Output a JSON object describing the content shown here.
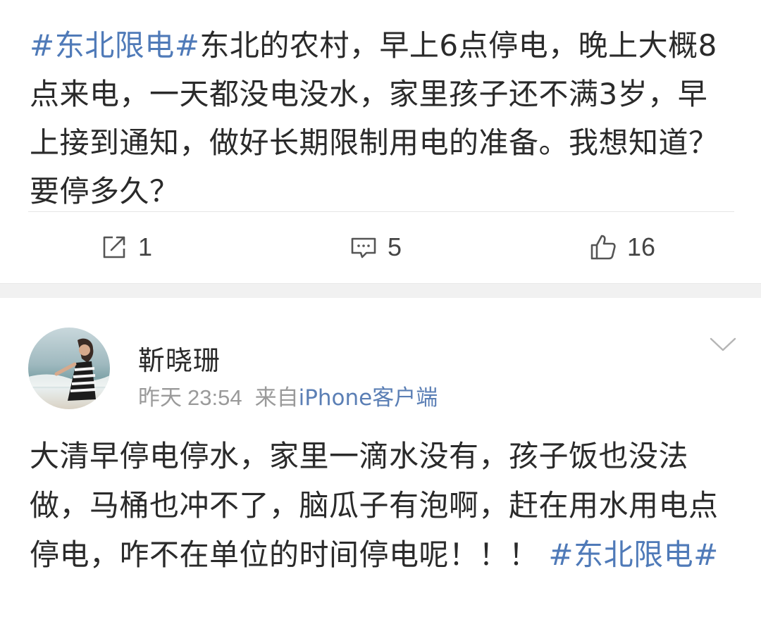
{
  "post": {
    "topic": "#东北限电#",
    "text": "东北的农村，早上6点停电，晚上大概8点来电，一天都没电没水，家里孩子还不满3岁，早上接到通知，做好长期限制用电的准备。我想知道？要停多久？",
    "actions": {
      "repost": {
        "icon": "repost-icon",
        "count": "1"
      },
      "comment": {
        "icon": "comment-icon",
        "count": "5"
      },
      "like": {
        "icon": "thumbs-up-icon",
        "count": "16"
      }
    }
  },
  "comment": {
    "username": "靳晓珊",
    "date": "昨天",
    "time": "23:54",
    "source_prefix": "来自",
    "source_client": "iPhone客户端",
    "text": "大清早停电停水，家里一滴水没有，孩子饭也没法做，马桶也冲不了，脑瓜子有泡啊，赶在用水用电点停电，咋不在单位的时间停电呢！！！",
    "topic": "#东北限电#"
  },
  "colors": {
    "topic_link": "#4f7ab8",
    "body_text": "#2a2a2a",
    "meta_text": "#9a9a9a",
    "separator_band": "#f1f1f1"
  }
}
